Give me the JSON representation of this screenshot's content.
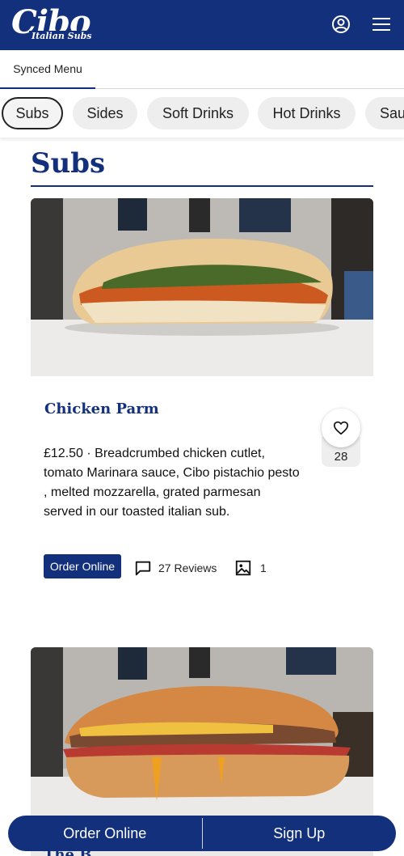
{
  "brand": {
    "logo_main": "Cibo",
    "logo_sub": "Italian Subs",
    "primary_color": "#13307c"
  },
  "header": {
    "account_icon": "user-circle-icon",
    "menu_icon": "hamburger-menu-icon"
  },
  "menu_tabs": [
    {
      "label": "Synced Menu",
      "active": true
    }
  ],
  "categories": [
    {
      "label": "Subs",
      "active": true
    },
    {
      "label": "Sides",
      "active": false
    },
    {
      "label": "Soft Drinks",
      "active": false
    },
    {
      "label": "Hot Drinks",
      "active": false
    },
    {
      "label": "Sau",
      "active": false
    }
  ],
  "section": {
    "title": "Subs"
  },
  "items": [
    {
      "name": "Chicken Parm",
      "description": "£12.50 · Breadcrumbed chicken cutlet, tomato Marinara sauce, Cibo pistachio pesto , melted mozzarella, grated parmesan served in our toasted italian sub.",
      "likes": "28",
      "order_label": "Order Online",
      "reviews_label": "27 Reviews",
      "photos_count": "1"
    },
    {
      "name": "The B"
    }
  ],
  "bottom_bar": {
    "order_label": "Order Online",
    "signup_label": "Sign Up"
  }
}
